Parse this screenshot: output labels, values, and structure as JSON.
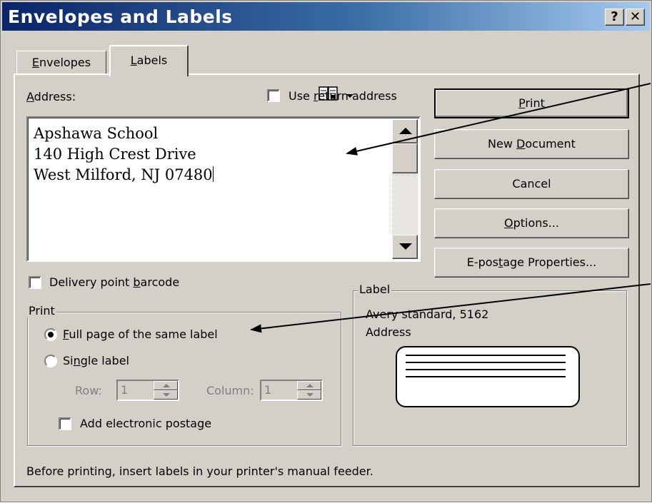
{
  "window": {
    "title": "Envelopes and Labels",
    "help_glyph": "?",
    "close_glyph": "✕"
  },
  "tabs": [
    {
      "label_prefix": "",
      "label_key": "E",
      "label_rest": "nvelopes",
      "active": false
    },
    {
      "label_prefix": "",
      "label_key": "L",
      "label_rest": "abels",
      "active": true
    }
  ],
  "address": {
    "label_key": "A",
    "label_rest": "ddress:",
    "lines": [
      "Apshawa School",
      "140 High Crest Drive",
      "West Milford, NJ 07480"
    ],
    "address_book_icon": "address-book-icon",
    "dropdown_icon": "chevron-down-icon"
  },
  "use_return_address": {
    "label_prefix": "Use ",
    "label_key": "r",
    "label_rest": "eturn address",
    "checked": false
  },
  "buttons": {
    "print": {
      "prefix": "",
      "key": "P",
      "rest": "rint"
    },
    "new_document": {
      "prefix": "New ",
      "key": "D",
      "rest": "ocument"
    },
    "cancel": {
      "label": "Cancel"
    },
    "options": {
      "prefix": "",
      "key": "O",
      "rest": "ptions..."
    },
    "epostage": {
      "prefix": "E-pos",
      "key": "t",
      "rest": "age Properties..."
    }
  },
  "delivery_barcode": {
    "prefix": "Delivery point ",
    "key": "b",
    "rest": "arcode",
    "checked": false
  },
  "print_group": {
    "title": "Print",
    "full_page": {
      "prefix": "",
      "key": "F",
      "rest": "ull page of the same label",
      "selected": true
    },
    "single_label": {
      "prefix": "Si",
      "key": "n",
      "rest": "gle label",
      "selected": false
    },
    "row_label": "Row:",
    "row_value": "1",
    "column_label": "Column:",
    "column_value": "1",
    "electronic_postage": {
      "prefix": "Add electronic posta",
      "key": "g",
      "rest": "e",
      "checked": false
    }
  },
  "label_group": {
    "title": "Label",
    "line1": "Avery standard, 5162",
    "line2": "Address"
  },
  "footer_text": "Before printing, insert labels in your printer's manual feeder.",
  "colors": {
    "dialog_bg": "#d4d0c8",
    "title_start": "#0a246a",
    "title_end": "#a6caf0"
  }
}
